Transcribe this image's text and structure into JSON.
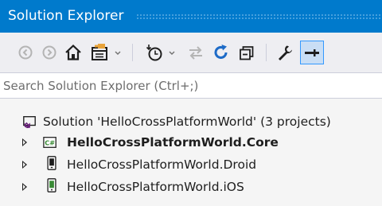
{
  "window": {
    "title": "Solution Explorer"
  },
  "toolbar": {
    "buttons": [
      {
        "name": "back-button",
        "icon": "back-arrow-icon",
        "enabled": false
      },
      {
        "name": "forward-button",
        "icon": "forward-arrow-icon",
        "enabled": false
      },
      {
        "name": "home-button",
        "icon": "home-icon",
        "enabled": true
      },
      {
        "name": "switch-views-button",
        "icon": "switch-views-icon",
        "enabled": true
      },
      {
        "name": "pending-changes-filter-button",
        "icon": "pending-changes-icon",
        "enabled": true
      },
      {
        "name": "sync-with-document-button",
        "icon": "sync-icon",
        "enabled": false
      },
      {
        "name": "refresh-button",
        "icon": "refresh-icon",
        "enabled": true
      },
      {
        "name": "collapse-all-button",
        "icon": "collapse-all-icon",
        "enabled": true
      },
      {
        "name": "properties-button",
        "icon": "wrench-icon",
        "enabled": true
      },
      {
        "name": "preview-selected-items-button",
        "icon": "preview-icon",
        "enabled": true,
        "pressed": true
      }
    ]
  },
  "search": {
    "placeholder": "Search Solution Explorer (Ctrl+;)",
    "value": ""
  },
  "tree": {
    "solution": {
      "label": "Solution 'HelloCrossPlatformWorld' (3 projects)",
      "icon": "visual-studio-solution-icon"
    },
    "projects": [
      {
        "label": "HelloCrossPlatformWorld.Core",
        "icon": "csharp-project-icon",
        "bold": true,
        "expanded": false
      },
      {
        "label": "HelloCrossPlatformWorld.Droid",
        "icon": "android-project-icon",
        "bold": false,
        "expanded": false
      },
      {
        "label": "HelloCrossPlatformWorld.iOS",
        "icon": "ios-project-icon",
        "bold": false,
        "expanded": false
      }
    ]
  },
  "colors": {
    "titlebar": "#007ACC",
    "toolbar": "#EEEEF2",
    "background": "#F5F5F5",
    "accent": "#3399FF",
    "vs_purple": "#68217A",
    "csharp_green": "#388A34"
  }
}
